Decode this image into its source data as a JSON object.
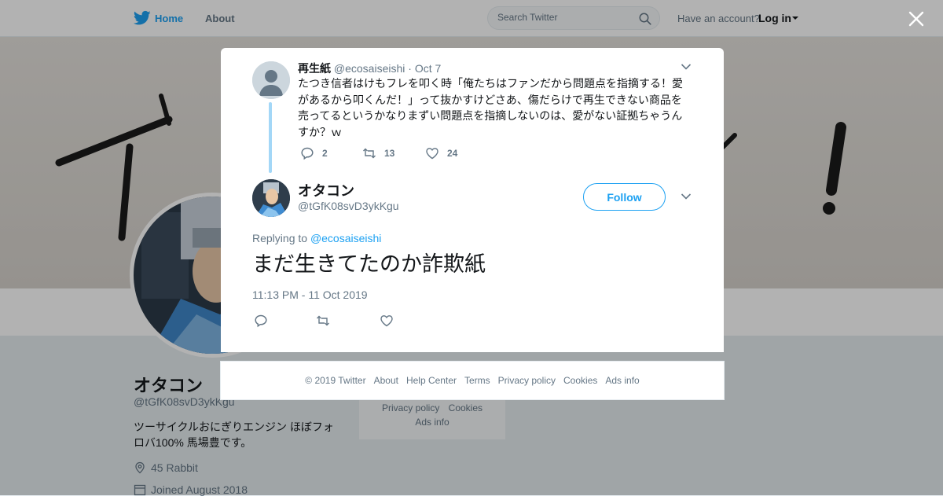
{
  "nav": {
    "home_label": "Home",
    "about_label": "About",
    "search_placeholder": "Search Twitter",
    "account_prompt": "Have an account?",
    "login_label": "Log in"
  },
  "banner": {
    "glyphs": [
      "イ",
      "！"
    ]
  },
  "profile": {
    "name": "オタコン",
    "handle": "@tGfK08svD3ykKgu",
    "bio": "ツーサイクルおにぎりエンジン ほぼフォロバ100% 馬場豊です。",
    "location": "45 Rabbit",
    "joined": "Joined August 2018",
    "footer_links": [
      "Privacy policy",
      "Cookies",
      "Ads info"
    ]
  },
  "parent_tweet": {
    "name": "再生紙",
    "handle": "@ecosaiseishi",
    "separator": "·",
    "date": "Oct 7",
    "text": "たつき信者はけもフレを叩く時「俺たちはファンだから問題点を指摘する！愛があるから叩くんだ！」って抜かすけどさあ、傷だらけで再生できない商品を売ってるというかなりまずい問題点を指摘しないのは、愛がない証拠ちゃうんすか？ｗ",
    "reply_count": "2",
    "retweet_count": "13",
    "like_count": "24"
  },
  "main_tweet": {
    "name": "オタコン",
    "handle": "@tGfK08svD3ykKgu",
    "follow_label": "Follow",
    "replying_prefix": "Replying to",
    "replying_to": "@ecosaiseishi",
    "text": "まだ生きてたのか詐欺紙",
    "timestamp": "11:13 PM - 11 Oct 2019"
  },
  "footer": {
    "links": [
      "© 2019 Twitter",
      "About",
      "Help Center",
      "Terms",
      "Privacy policy",
      "Cookies",
      "Ads info"
    ]
  },
  "colors": {
    "accent": "#1da1f2",
    "muted": "#657786",
    "text": "#14171a"
  },
  "icons": [
    "twitter-bird-icon",
    "search-icon",
    "close-icon",
    "chevron-down-icon",
    "reply-icon",
    "retweet-icon",
    "like-icon",
    "location-icon",
    "calendar-icon"
  ]
}
